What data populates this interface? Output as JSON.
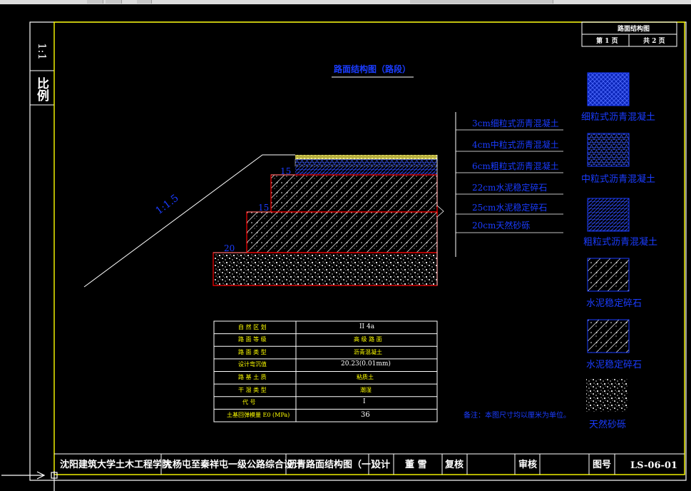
{
  "sheet": {
    "scale_label": "比例",
    "scale_value": "1:1",
    "box_title": "路面结构图",
    "page_current": "第 1 页",
    "page_total": "共 2 页"
  },
  "drawing": {
    "title": "路面结构图（路段）",
    "slope_label": "1:1.5",
    "dim_top": "15",
    "dim_mid": "15",
    "dim_bottom": "20",
    "layer_labels": [
      "3cm细粒式沥青混凝土",
      "4cm中粒式沥青混凝土",
      "6cm粗粒式沥青混凝土",
      "22cm水泥稳定碎石",
      "25cm水泥稳定碎石",
      "20cm天然砂砾"
    ]
  },
  "legend": [
    {
      "name": "细粒式沥青混凝土",
      "pattern": "fine-asphalt"
    },
    {
      "name": "中粒式沥青混凝土",
      "pattern": "medium-asphalt"
    },
    {
      "name": "粗粒式沥青混凝土",
      "pattern": "coarse-asphalt"
    },
    {
      "name": "水泥稳定碎石",
      "pattern": "cement-gravel"
    },
    {
      "name": "水泥稳定碎石",
      "pattern": "cement-gravel"
    },
    {
      "name": "天然砂砾",
      "pattern": "natural-sand-gravel"
    }
  ],
  "param_table": {
    "rows": [
      [
        "自 然 区 划",
        "II 4a"
      ],
      [
        "路 面 等 级",
        "高 级 路 面"
      ],
      [
        "路 面 类 型",
        "沥青混凝土"
      ],
      [
        "设计弯沉值",
        "20.23(0.01mm)"
      ],
      [
        "路 基 土 质",
        "粘质土"
      ],
      [
        "干 湿 类 型",
        "潮湿"
      ],
      [
        "代 号",
        "I"
      ],
      [
        "土基回弹模量 E0 (MPa)",
        "36"
      ]
    ]
  },
  "note": "备注：本图尺寸均以厘米为单位。",
  "title_block": {
    "school": "沈阳建筑大学土木工程学院",
    "project": "大杨屯至秦祥屯一级公路综合设计",
    "drawing_name": "沥青路面结构图（一）",
    "design_label": "设计",
    "designer": "董 雪",
    "review_label": "复核",
    "approve_label": "审核",
    "drawing_no_label": "图号",
    "drawing_no": "LS-06-01"
  },
  "colors": {
    "background": "#000000",
    "frame_line": "#ffff00",
    "layer_outline": "#ff0000",
    "annotation": "#1a3cff",
    "text": "#ffffff"
  }
}
